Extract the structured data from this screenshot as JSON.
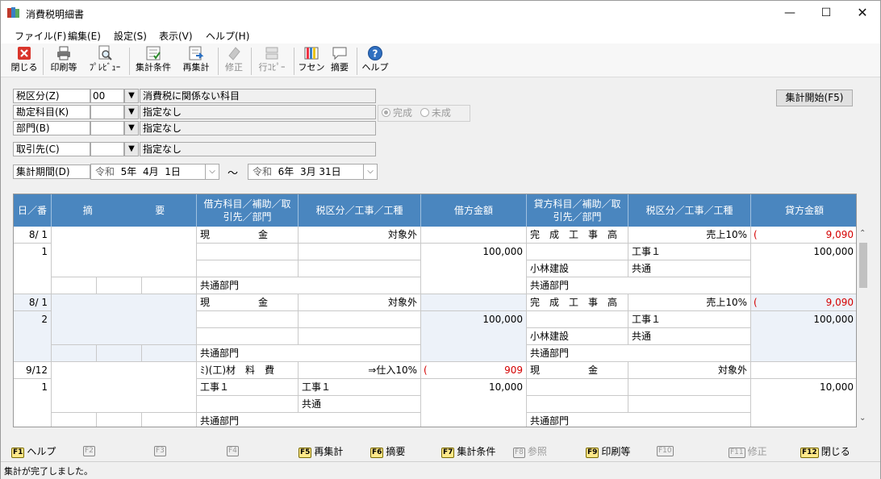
{
  "window": {
    "title": "消費税明細書"
  },
  "menu": [
    "ファイル(F)",
    "編集(E)",
    "設定(S)",
    "表示(V)",
    "ヘルプ(H)"
  ],
  "toolbar": {
    "close": "閉じる",
    "print": "印刷等",
    "preview": "ﾌﾟﾚﾋﾞｭｰ",
    "agg_cond": "集計条件",
    "reagg": "再集計",
    "edit": "修正",
    "row_copy": "行ｺﾋﾟｰ",
    "fusen": "フセン",
    "summary": "摘要",
    "help": "ヘルプ"
  },
  "filters": {
    "tax_label": "税区分(Z)",
    "tax_code": "00",
    "tax_desc": "消費税に関係ない科目",
    "account_label": "勘定科目(K)",
    "account_desc": "指定なし",
    "dept_label": "部門(B)",
    "dept_desc": "指定なし",
    "partner_label": "取引先(C)",
    "partner_desc": "指定なし",
    "period_label": "集計期間(D)",
    "from": {
      "era": "令和",
      "y": "5年",
      "m": "4月",
      "d": "1日"
    },
    "tilde": "〜",
    "to": {
      "era": "令和",
      "y": "6年",
      "m": "3月",
      "d": "31日"
    },
    "radio_done": "完成",
    "radio_undone": "未成",
    "start_button": "集計開始(F5)"
  },
  "grid": {
    "headers": {
      "date": "日／番",
      "summary1": "摘",
      "summary2": "要",
      "debit_acct": "借方科目／補助／取引先／部門",
      "debit_tax": "税区分／工事／工種",
      "debit_amt": "借方金額",
      "credit_acct": "貸方科目／補助／取引先／部門",
      "credit_tax": "税区分／工事／工種",
      "credit_amt": "貸方金額"
    },
    "rows": [
      {
        "date": "8/ 1",
        "no": "1",
        "d_acct": "現　　　　　金",
        "d_tax": "対象外",
        "d_amt": "100,000",
        "d_dept": "共通部門",
        "c_acct": "完　成　工　事　高",
        "c_tax": "売上10%",
        "c_tax_amt": "9,090",
        "c_sub1": "工事１",
        "c_partner": "小林建設",
        "c_koshu": "共通",
        "c_amt": "100,000",
        "c_dept": "共通部門"
      },
      {
        "date": "8/ 1",
        "no": "2",
        "d_acct": "現　　　　　金",
        "d_tax": "対象外",
        "d_amt": "100,000",
        "d_dept": "共通部門",
        "c_acct": "完　成　工　事　高",
        "c_tax": "売上10%",
        "c_tax_amt": "9,090",
        "c_sub1": "工事１",
        "c_partner": "小林建設",
        "c_koshu": "共通",
        "c_amt": "100,000",
        "c_dept": "共通部門"
      },
      {
        "date": "9/12",
        "no": "1",
        "d_acct": "ﾐ)(工)材　料　費",
        "d_tax": "⇒仕入10%",
        "d_tax_amt": "909",
        "d_sub1": "工事１",
        "d_koshu": "共通",
        "d_amt": "10,000",
        "d_dept": "共通部門",
        "c_acct": "現　　　　　金",
        "c_tax": "対象外",
        "c_amt": "10,000",
        "c_dept": "共通部門"
      }
    ]
  },
  "fkeys": [
    {
      "key": "F1",
      "label": "ヘルプ",
      "on": true
    },
    {
      "key": "F2",
      "label": "",
      "on": false
    },
    {
      "key": "F3",
      "label": "",
      "on": false
    },
    {
      "key": "F4",
      "label": "",
      "on": false
    },
    {
      "key": "F5",
      "label": "再集計",
      "on": true
    },
    {
      "key": "F6",
      "label": "摘要",
      "on": true
    },
    {
      "key": "F7",
      "label": "集計条件",
      "on": true
    },
    {
      "key": "F8",
      "label": "参照",
      "on": false
    },
    {
      "key": "F9",
      "label": "印刷等",
      "on": true
    },
    {
      "key": "F10",
      "label": "",
      "on": false
    },
    {
      "key": "F11",
      "label": "修正",
      "on": false
    },
    {
      "key": "F12",
      "label": "閉じる",
      "on": true
    }
  ],
  "status": "集計が完了しました。",
  "colors": {
    "header_blue": "#4a86bf",
    "shade": "#edf2f9",
    "red": "#d40000"
  }
}
